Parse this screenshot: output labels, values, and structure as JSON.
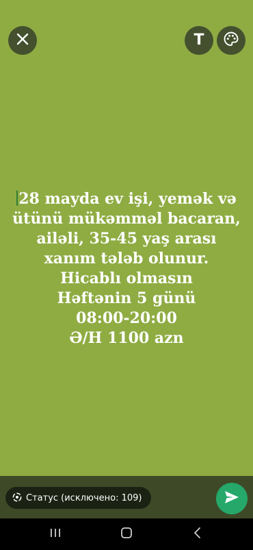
{
  "top_bar": {
    "close_icon": "close-icon",
    "text_tool_label": "T",
    "palette_icon": "palette-icon"
  },
  "status": {
    "text": "28 mayda ev işi, yemək  və\nütünü mükəmməl bacaran,\nailəli, 35-45 yaş arası\nxanım tələb olunur.\nHicablı olmasın\nHəftənin 5 günü\n08:00-20:00\nƏ/H 1100 azn",
    "background_color": "#8fac43",
    "text_color": "#ffffff"
  },
  "bottom_bar": {
    "audience_label": "Статус (исключено: 109)",
    "audience_icon": "status-icon",
    "send_icon": "send-icon",
    "send_color": "#25a86a"
  },
  "navbar": {
    "recents_icon": "recents-icon",
    "home_icon": "home-icon",
    "back_icon": "back-icon"
  }
}
